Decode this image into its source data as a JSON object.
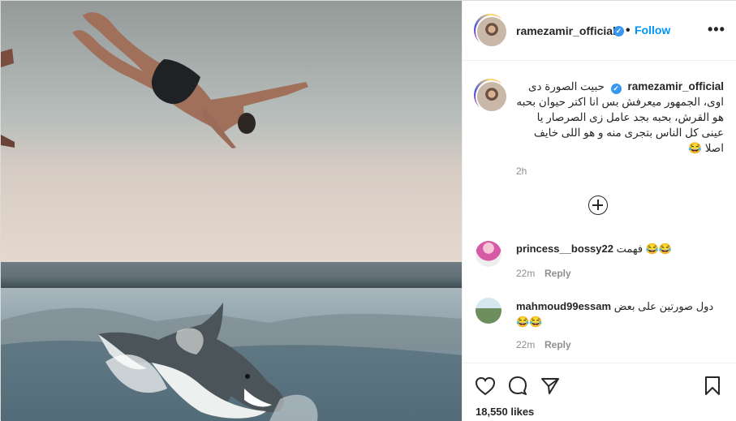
{
  "header": {
    "username": "ramezamir_official",
    "follow_label": "Follow",
    "more_icon": "more-options-icon",
    "verified_icon": "verified-badge-icon"
  },
  "caption": {
    "username": "ramezamir_official",
    "text": "حبيت الصورة دى اوى، الجمهور ميعرفش بس انا اكتر حيوان بحبه هو القرش، بحبه بجد عامل زى الصرصار يا عينى كل الناس بتجرى منه و هو اللى خايف اصلا 😂",
    "time": "2h"
  },
  "load_more_icon": "plus-circle-icon",
  "comments": [
    {
      "username": "princess__bossy22",
      "text": "فهمت 😂😂",
      "time": "22m",
      "reply_label": "Reply"
    },
    {
      "username": "mahmoud99essam",
      "text": "دول صورتين على بعض😂😂",
      "time": "22m",
      "reply_label": "Reply"
    }
  ],
  "actions": {
    "like_icon": "heart-icon",
    "comment_icon": "comment-icon",
    "share_icon": "share-icon",
    "save_icon": "bookmark-icon"
  },
  "likes": "18,550 likes",
  "colors": {
    "accent": "#0095f6",
    "verified": "#3897f0",
    "muted": "#8e8e8e",
    "border": "#dbdbdb"
  }
}
